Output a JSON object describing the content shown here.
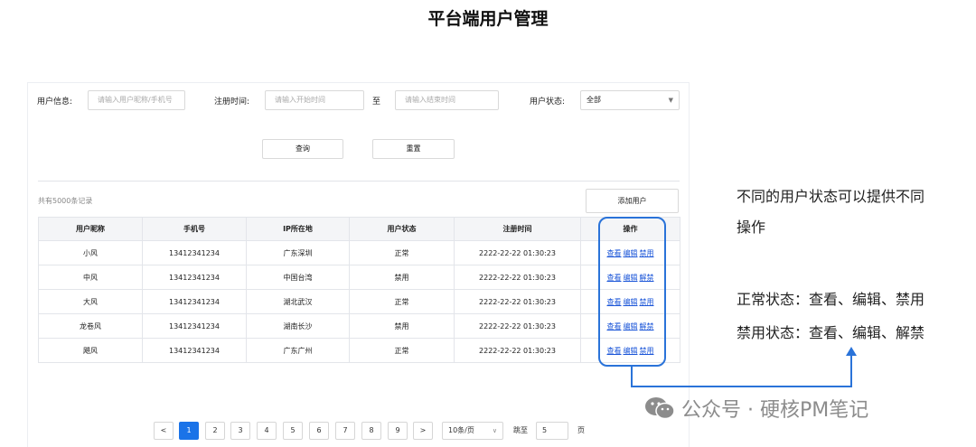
{
  "title": "平台端用户管理",
  "filters": {
    "user_info_label": "用户信息:",
    "user_info_placeholder": "请输入用户昵称/手机号",
    "reg_time_label": "注册时间:",
    "start_placeholder": "请输入开始时间",
    "to_label": "至",
    "end_placeholder": "请输入结束时间",
    "status_label": "用户状态:",
    "status_value": "全部"
  },
  "actions": {
    "query": "查询",
    "reset": "重置",
    "add_user": "添加用户"
  },
  "record_count": "共有5000条记录",
  "table": {
    "headers": [
      "用户昵称",
      "手机号",
      "IP所在地",
      "用户状态",
      "注册时间",
      "操作"
    ],
    "rows": [
      {
        "name": "小风",
        "phone": "13412341234",
        "ip": "广东深圳",
        "status": "正常",
        "time": "2222-22-22 01:30:23",
        "ops": [
          "查看",
          "编辑",
          "禁用"
        ]
      },
      {
        "name": "中风",
        "phone": "13412341234",
        "ip": "中国台湾",
        "status": "禁用",
        "time": "2222-22-22 01:30:23",
        "ops": [
          "查看",
          "编辑",
          "解禁"
        ]
      },
      {
        "name": "大风",
        "phone": "13412341234",
        "ip": "湖北武汉",
        "status": "正常",
        "time": "2222-22-22 01:30:23",
        "ops": [
          "查看",
          "编辑",
          "禁用"
        ]
      },
      {
        "name": "龙卷风",
        "phone": "13412341234",
        "ip": "湖南长沙",
        "status": "禁用",
        "time": "2222-22-22 01:30:23",
        "ops": [
          "查看",
          "编辑",
          "解禁"
        ]
      },
      {
        "name": "飓风",
        "phone": "13412341234",
        "ip": "广东广州",
        "status": "正常",
        "time": "2222-22-22 01:30:23",
        "ops": [
          "查看",
          "编辑",
          "禁用"
        ]
      }
    ]
  },
  "pagination": {
    "prev": "<",
    "pages": [
      "1",
      "2",
      "3",
      "4",
      "5",
      "6",
      "7",
      "8",
      "9"
    ],
    "current_page": 1,
    "next": ">",
    "page_size": "10条/页",
    "jump_label": "跳至",
    "jump_value": "5",
    "page_unit": "页"
  },
  "annotations": {
    "line1": "不同的用户状态可以提供不同",
    "line2": "操作",
    "line3": "正常状态：查看、编辑、禁用",
    "line4": "禁用状态：查看、编辑、解禁"
  },
  "watermark": "公众号 · 硬核PM笔记",
  "colors": {
    "accent": "#1a73e8",
    "link": "#1a55d8",
    "highlight": "#2a73d9"
  }
}
